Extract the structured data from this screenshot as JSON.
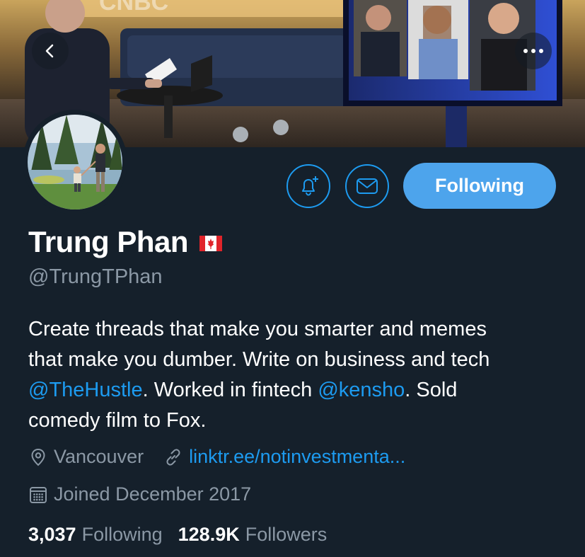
{
  "banner": {
    "watermark": "CNBC",
    "back_icon": "chevron-left-icon",
    "more_icon": "more-horizontal-icon"
  },
  "actions": {
    "notify_icon": "bell-plus-icon",
    "message_icon": "envelope-icon",
    "following_label": "Following"
  },
  "profile": {
    "name": "Trung Phan",
    "flag_icon": "canada-flag-icon",
    "handle": "@TrungTPhan",
    "bio": {
      "line1": "Create threads that make you smarter and memes",
      "line2": "that make you dumber. Write on business and tech",
      "mention1": "@TheHustle",
      "text_after_mention1": ". Worked in fintech ",
      "mention2": "@kensho",
      "text_after_mention2": ". Sold",
      "line4": "comedy film to Fox."
    },
    "location": "Vancouver",
    "link": "linktr.ee/notinvestmenta...",
    "joined": "Joined December 2017"
  },
  "stats": {
    "following_count": "3,037",
    "following_label": "Following",
    "followers_count": "128.9K",
    "followers_label": "Followers"
  },
  "colors": {
    "background": "#15202b",
    "accent": "#1d9bf0",
    "following_button": "#4da4ec",
    "secondary_text": "#8b98a5"
  }
}
